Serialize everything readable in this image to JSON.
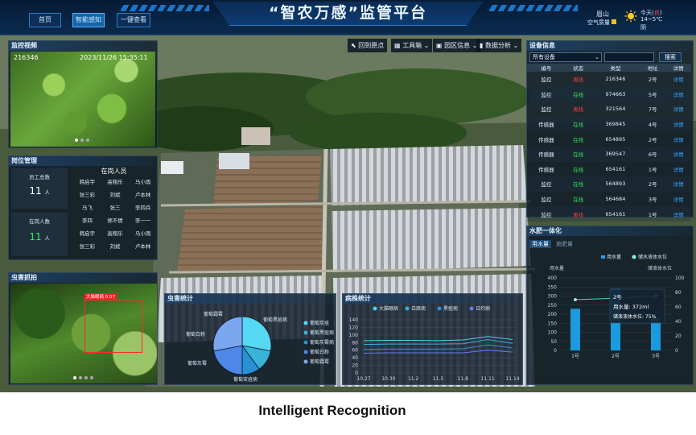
{
  "nav": {
    "home": "首页",
    "smart": "智能感知",
    "onekey": "一键查看"
  },
  "app_title": "“智农万感”监管平台",
  "weather": {
    "location": "眉山",
    "air": "空气质量",
    "today": "今天(",
    "today_red": "良",
    "today_end": ")",
    "temp": "14~5℃",
    "cond": "阴"
  },
  "toolbar": {
    "back": "回到原点",
    "tools": "工具箱",
    "area": "园区信息",
    "data": "数据分析"
  },
  "video": {
    "title": "监控视频",
    "device_id": "216346",
    "timestamp": "2023/11/26 15:35:11"
  },
  "staff": {
    "title": "岗位管理",
    "total_label": "员工总数",
    "total": "11",
    "unit": "人",
    "onduty_label": "在岗人数",
    "onduty": "11",
    "list_title": "在岗人员",
    "names": [
      "韩启宇",
      "高翔乐",
      "马小雨",
      "张三彩",
      "刘斌",
      "卢本林",
      "马飞",
      "张三",
      "李四兵",
      "李四",
      "郑不倩",
      "李一一",
      "韩启宇",
      "高翔乐",
      "马小雨",
      "张三彩",
      "刘斌",
      "卢本林"
    ]
  },
  "pest_capture": {
    "title": "虫害抓拍",
    "detect_label": "大猫眼病 0.57"
  },
  "pest_stats": {
    "title": "虫害统计",
    "labels": [
      "葡萄霜霉",
      "葡萄白粉",
      "葡萄灰霉",
      "葡萄炭疽病",
      "葡萄黑痘病"
    ],
    "legend": [
      "葡萄炭疽",
      "葡萄黑痘病",
      "葡萄灰霉病",
      "葡萄白粉",
      "葡萄霜霉"
    ],
    "values": [
      28,
      12,
      10,
      22,
      28
    ],
    "colors": [
      "#56d8f2",
      "#39b4d8",
      "#2890d6",
      "#4f86e8",
      "#7aa7ef"
    ]
  },
  "disease_stats": {
    "title": "病株统计",
    "legend": [
      "大猫眼病",
      "白腐病",
      "黑痘病",
      "日灼病"
    ],
    "colors": [
      "#4ad2f0",
      "#36b1da",
      "#3a8de0",
      "#5f7df0"
    ],
    "yticks": [
      "140",
      "120",
      "100",
      "80",
      "60",
      "40",
      "20",
      "0"
    ],
    "xticks": [
      "10.27",
      "10.30",
      "11.2",
      "11.5",
      "11.8",
      "11.11",
      "11.14"
    ]
  },
  "chart_data": [
    {
      "type": "pie",
      "title": "虫害统计",
      "categories": [
        "葡萄炭疽",
        "葡萄黑痘病",
        "葡萄灰霉病",
        "葡萄白粉",
        "葡萄霜霉"
      ],
      "values": [
        28,
        12,
        10,
        22,
        28
      ]
    },
    {
      "type": "line",
      "title": "病株统计",
      "x": [
        "10.27",
        "10.30",
        "11.2",
        "11.5",
        "11.8",
        "11.11",
        "11.14"
      ],
      "ylim": [
        0,
        140
      ],
      "series": [
        {
          "name": "大猫眼病",
          "values": [
            85,
            86,
            86,
            85,
            87,
            96,
            88
          ]
        },
        {
          "name": "白腐病",
          "values": [
            75,
            76,
            76,
            76,
            77,
            88,
            78
          ]
        },
        {
          "name": "黑痘病",
          "values": [
            62,
            63,
            63,
            63,
            64,
            74,
            66
          ]
        },
        {
          "name": "日灼病",
          "values": [
            52,
            53,
            53,
            53,
            53,
            60,
            55
          ]
        }
      ]
    },
    {
      "type": "bar",
      "title": "用水量",
      "categories": [
        "1号",
        "2号",
        "3号"
      ],
      "values": [
        230,
        340,
        180
      ],
      "line_series": {
        "name": "储水液体水位",
        "values": [
          70,
          72,
          75
        ]
      },
      "ylim": [
        0,
        400
      ],
      "y2lim": [
        0,
        100
      ]
    }
  ],
  "devices": {
    "title": "设备信息",
    "filter": "所有设备",
    "search": "搜索",
    "headers": [
      "编号",
      "状态",
      "类型",
      "地址",
      "详情"
    ],
    "rows": [
      {
        "type": "监控",
        "status": "离线",
        "id": "216346",
        "addr": "2号",
        "detail": "详情"
      },
      {
        "type": "监控",
        "status": "在线",
        "id": "974663",
        "addr": "5号",
        "detail": "详情"
      },
      {
        "type": "监控",
        "status": "离线",
        "id": "321564",
        "addr": "7号",
        "detail": "详情"
      },
      {
        "type": "传感器",
        "status": "在线",
        "id": "369845",
        "addr": "4号",
        "detail": "详情"
      },
      {
        "type": "传感器",
        "status": "在线",
        "id": "654895",
        "addr": "2号",
        "detail": "详情"
      },
      {
        "type": "传感器",
        "status": "在线",
        "id": "369547",
        "addr": "6号",
        "detail": "详情"
      },
      {
        "type": "传感器",
        "status": "在线",
        "id": "654161",
        "addr": "1号",
        "detail": "详情"
      },
      {
        "type": "监控",
        "status": "在线",
        "id": "564893",
        "addr": "2号",
        "detail": "详情"
      },
      {
        "type": "监控",
        "status": "在线",
        "id": "564684",
        "addr": "3号",
        "detail": "详情"
      },
      {
        "type": "监控",
        "status": "离线",
        "id": "654161",
        "addr": "1号",
        "detail": "详情"
      }
    ]
  },
  "water": {
    "title": "水肥一体化",
    "tab_active": "用水量",
    "tab_other": "施肥量",
    "legend_bar": "用水量",
    "legend_line": "储水液体水位",
    "ylabel": "用水量",
    "y2label": "储液体水位",
    "yticks": [
      "400",
      "350",
      "300",
      "250",
      "200",
      "150",
      "100",
      "50",
      "0"
    ],
    "y2ticks": [
      "100",
      "80",
      "60",
      "40",
      "20",
      "0"
    ],
    "xcats": [
      "1号",
      "2号",
      "3号"
    ],
    "tooltip": {
      "title": "2号",
      "water": "用水量: 372ml",
      "level": "储液液体水位: 75%"
    }
  },
  "caption": "Intelligent Recognition"
}
